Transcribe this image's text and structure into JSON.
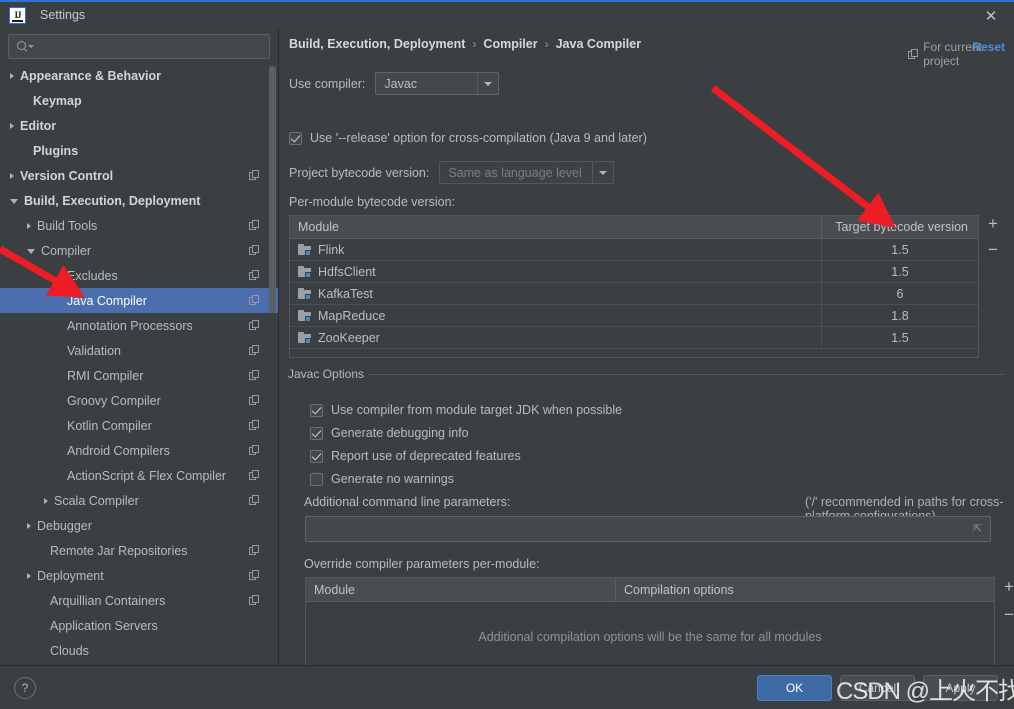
{
  "window": {
    "title": "Settings",
    "logo_text": "IJ",
    "close_icon": "close-icon"
  },
  "sidebar": {
    "search": {
      "placeholder": "",
      "value": "",
      "icon": "search-icon"
    },
    "items": [
      {
        "label": "Appearance & Behavior",
        "expander": "collapsed",
        "indent": 0,
        "bold": true,
        "copy": false,
        "selected": false
      },
      {
        "label": "Keymap",
        "expander": "none",
        "indent": 1,
        "bold": true,
        "copy": false,
        "selected": false
      },
      {
        "label": "Editor",
        "expander": "collapsed",
        "indent": 0,
        "bold": true,
        "copy": false,
        "selected": false
      },
      {
        "label": "Plugins",
        "expander": "none",
        "indent": 1,
        "bold": true,
        "copy": false,
        "selected": false
      },
      {
        "label": "Version Control",
        "expander": "collapsed",
        "indent": 0,
        "bold": true,
        "copy": true,
        "selected": false
      },
      {
        "label": "Build, Execution, Deployment",
        "expander": "expanded",
        "indent": 0,
        "bold": true,
        "copy": false,
        "selected": false
      },
      {
        "label": "Build Tools",
        "expander": "collapsed",
        "indent": 1,
        "bold": false,
        "copy": true,
        "selected": false
      },
      {
        "label": "Compiler",
        "expander": "expanded",
        "indent": 1,
        "bold": false,
        "copy": true,
        "selected": false
      },
      {
        "label": "Excludes",
        "expander": "none",
        "indent": 3,
        "bold": false,
        "copy": true,
        "selected": false
      },
      {
        "label": "Java Compiler",
        "expander": "none",
        "indent": 3,
        "bold": false,
        "copy": true,
        "selected": true
      },
      {
        "label": "Annotation Processors",
        "expander": "none",
        "indent": 3,
        "bold": false,
        "copy": true,
        "selected": false
      },
      {
        "label": "Validation",
        "expander": "none",
        "indent": 3,
        "bold": false,
        "copy": true,
        "selected": false
      },
      {
        "label": "RMI Compiler",
        "expander": "none",
        "indent": 3,
        "bold": false,
        "copy": true,
        "selected": false
      },
      {
        "label": "Groovy Compiler",
        "expander": "none",
        "indent": 3,
        "bold": false,
        "copy": true,
        "selected": false
      },
      {
        "label": "Kotlin Compiler",
        "expander": "none",
        "indent": 3,
        "bold": false,
        "copy": true,
        "selected": false
      },
      {
        "label": "Android Compilers",
        "expander": "none",
        "indent": 3,
        "bold": false,
        "copy": true,
        "selected": false
      },
      {
        "label": "ActionScript & Flex Compiler",
        "expander": "none",
        "indent": 3,
        "bold": false,
        "copy": true,
        "selected": false
      },
      {
        "label": "Scala Compiler",
        "expander": "collapsed",
        "indent": 2,
        "bold": false,
        "copy": true,
        "selected": false
      },
      {
        "label": "Debugger",
        "expander": "collapsed",
        "indent": 1,
        "bold": false,
        "copy": false,
        "selected": false
      },
      {
        "label": "Remote Jar Repositories",
        "expander": "none",
        "indent": 2,
        "bold": false,
        "copy": true,
        "selected": false
      },
      {
        "label": "Deployment",
        "expander": "collapsed",
        "indent": 1,
        "bold": false,
        "copy": true,
        "selected": false
      },
      {
        "label": "Arquillian Containers",
        "expander": "none",
        "indent": 2,
        "bold": false,
        "copy": true,
        "selected": false
      },
      {
        "label": "Application Servers",
        "expander": "none",
        "indent": 2,
        "bold": false,
        "copy": false,
        "selected": false
      },
      {
        "label": "Clouds",
        "expander": "none",
        "indent": 2,
        "bold": false,
        "copy": false,
        "selected": false
      }
    ]
  },
  "main": {
    "breadcrumb": [
      "Build, Execution, Deployment",
      "Compiler",
      "Java Compiler"
    ],
    "breadcrumb_sep": "›",
    "for_current_project": "For current project",
    "reset_label": "Reset",
    "use_compiler_label": "Use compiler:",
    "use_compiler_value": "Javac",
    "release_option_label": "Use '--release' option for cross-compilation (Java 9 and later)",
    "release_option_checked": true,
    "project_bytecode_label": "Project bytecode version:",
    "project_bytecode_value": "Same as language level",
    "project_bytecode_disabled": true,
    "per_module_label": "Per-module bytecode version:",
    "module_table": {
      "columns": [
        "Module",
        "Target bytecode version"
      ],
      "rows": [
        {
          "module": "Flink",
          "version": "1.5"
        },
        {
          "module": "HdfsClient",
          "version": "1.5"
        },
        {
          "module": "KafkaTest",
          "version": "6"
        },
        {
          "module": "MapReduce",
          "version": "1.8"
        },
        {
          "module": "ZooKeeper",
          "version": "1.5"
        }
      ],
      "add_label": "+",
      "remove_label": "−"
    },
    "javac_group_title": "Javac Options",
    "javac_options": [
      {
        "label": "Use compiler from module target JDK when possible",
        "checked": true
      },
      {
        "label": "Generate debugging info",
        "checked": true
      },
      {
        "label": "Report use of deprecated features",
        "checked": true
      },
      {
        "label": "Generate no warnings",
        "checked": false
      }
    ],
    "additional_params_label": "Additional command line parameters:",
    "additional_params_hint": "('/' recommended in paths for cross-platform configurations)",
    "additional_params_value": "",
    "override_label": "Override compiler parameters per-module:",
    "override_table": {
      "columns": [
        "Module",
        "Compilation options"
      ],
      "empty_text": "Additional compilation options will be the same for all modules",
      "add_label": "+",
      "remove_label": "−"
    }
  },
  "footer": {
    "help_label": "?",
    "ok_label": "OK",
    "cancel_label": "Cancel",
    "apply_label": "Apply"
  },
  "watermark": "CSDN @上火不找我",
  "colors": {
    "background": "#3c3f41",
    "selection": "#4b6eaf",
    "accent_link": "#4a90e2",
    "ok_button": "#3c6ba5",
    "annotation_arrow": "#ee1c24",
    "title_accent": "#2d74da"
  }
}
